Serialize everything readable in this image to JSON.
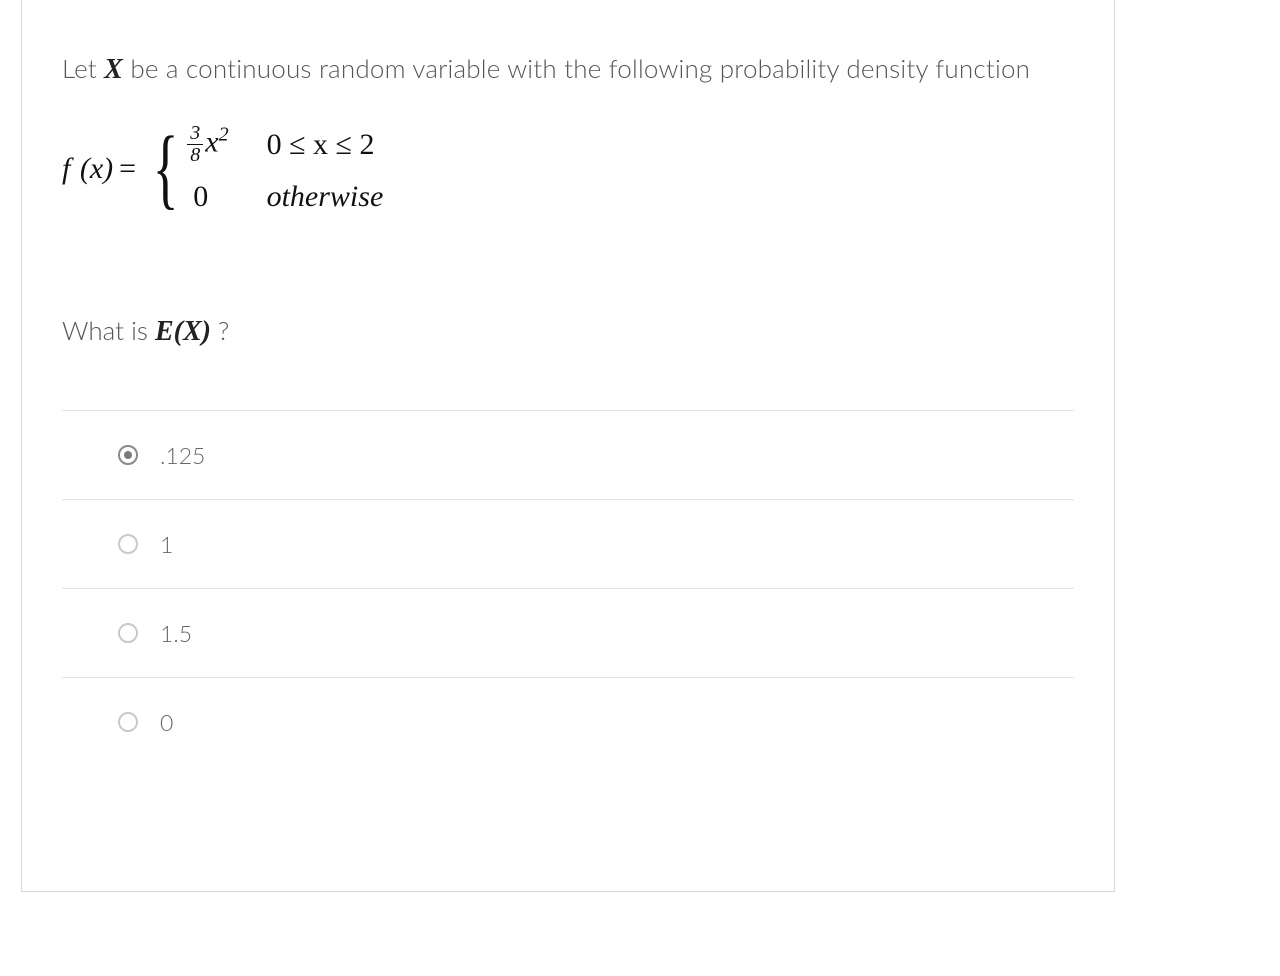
{
  "prompt": {
    "pre": "Let ",
    "var": "X",
    "post": " be a continuous random variable with the following probability density function"
  },
  "formula": {
    "lhs_f": "f",
    "lhs_x": "(x)",
    "eq": " = ",
    "case1_frac_num": "3",
    "case1_frac_den": "8",
    "case1_x": "x",
    "case1_exp": "2",
    "case1_cond": "0 ≤ x ≤ 2",
    "case2_val": "0",
    "case2_cond": "otherwise"
  },
  "question": {
    "pre": "What is ",
    "expr": "E(X)",
    "post": " ?"
  },
  "options": [
    {
      "label": ".125",
      "selected": true
    },
    {
      "label": "1",
      "selected": false
    },
    {
      "label": "1.5",
      "selected": false
    },
    {
      "label": "0",
      "selected": false
    }
  ]
}
